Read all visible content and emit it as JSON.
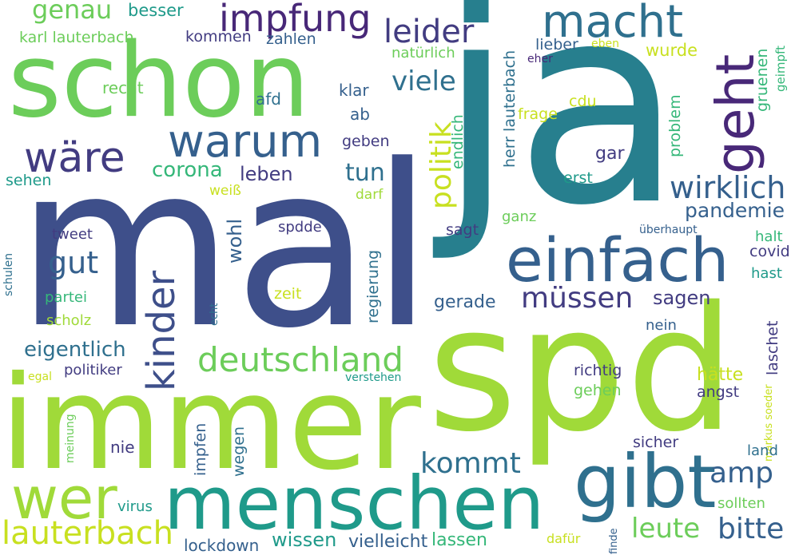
{
  "colors": {
    "indigo": "#423c81",
    "navy": "#3e4f8a",
    "blue": "#35608d",
    "steel": "#2f708e",
    "teal": "#277f8e",
    "sea": "#1f9a8a",
    "green": "#35b779",
    "lime": "#6ccd5a",
    "chartreuse": "#a0da39",
    "yellow": "#c8e020",
    "purple": "#482878"
  },
  "words": [
    {
      "text": "ja",
      "color": "teal"
    },
    {
      "text": "mal",
      "color": "navy"
    },
    {
      "text": "spd",
      "color": "chartreuse"
    },
    {
      "text": "immer",
      "color": "chartreuse"
    },
    {
      "text": "schon",
      "color": "lime"
    },
    {
      "text": "menschen",
      "color": "sea"
    },
    {
      "text": "gibt",
      "color": "steel"
    },
    {
      "text": "einfach",
      "color": "blue"
    },
    {
      "text": "geht",
      "color": "purple"
    },
    {
      "text": "wer",
      "color": "chartreuse"
    },
    {
      "text": "macht",
      "color": "steel"
    },
    {
      "text": "warum",
      "color": "blue"
    },
    {
      "text": "wäre",
      "color": "indigo"
    },
    {
      "text": "impfung",
      "color": "purple"
    },
    {
      "text": "kinder",
      "color": "navy"
    },
    {
      "text": "deutschland",
      "color": "lime"
    },
    {
      "text": "lauterbach",
      "color": "yellow"
    },
    {
      "text": "leider",
      "color": "indigo"
    },
    {
      "text": "wirklich",
      "color": "blue"
    },
    {
      "text": "müssen",
      "color": "indigo"
    },
    {
      "text": "politik",
      "color": "yellow"
    },
    {
      "text": "kommt",
      "color": "steel"
    },
    {
      "text": "amp",
      "color": "blue"
    },
    {
      "text": "bitte",
      "color": "blue"
    },
    {
      "text": "leute",
      "color": "lime"
    },
    {
      "text": "gut",
      "color": "blue"
    },
    {
      "text": "viele",
      "color": "steel"
    },
    {
      "text": "genau",
      "color": "lime"
    },
    {
      "text": "tun",
      "color": "steel"
    },
    {
      "text": "corona",
      "color": "green"
    },
    {
      "text": "eigentlich",
      "color": "steel"
    },
    {
      "text": "pandemie",
      "color": "blue"
    },
    {
      "text": "leben",
      "color": "indigo"
    },
    {
      "text": "sagen",
      "color": "indigo"
    },
    {
      "text": "wohl",
      "color": "blue"
    },
    {
      "text": "wissen",
      "color": "sea"
    },
    {
      "text": "vielleicht",
      "color": "blue"
    },
    {
      "text": "lassen",
      "color": "green"
    },
    {
      "text": "lockdown",
      "color": "blue"
    },
    {
      "text": "gar",
      "color": "indigo"
    },
    {
      "text": "gerade",
      "color": "blue"
    },
    {
      "text": "herr lauterbach",
      "color": "steel"
    },
    {
      "text": "besser",
      "color": "sea"
    },
    {
      "text": "karl lauterbach",
      "color": "lime"
    },
    {
      "text": "kommen",
      "color": "indigo"
    },
    {
      "text": "zahlen",
      "color": "blue"
    },
    {
      "text": "recht",
      "color": "lime"
    },
    {
      "text": "afd",
      "color": "steel"
    },
    {
      "text": "klar",
      "color": "blue"
    },
    {
      "text": "ab",
      "color": "blue"
    },
    {
      "text": "geben",
      "color": "indigo"
    },
    {
      "text": "natürlich",
      "color": "lime"
    },
    {
      "text": "lieber",
      "color": "blue"
    },
    {
      "text": "eben",
      "color": "yellow"
    },
    {
      "text": "eher",
      "color": "purple"
    },
    {
      "text": "wurde",
      "color": "yellow"
    },
    {
      "text": "gruenen",
      "color": "green"
    },
    {
      "text": "geimpft",
      "color": "green"
    },
    {
      "text": "cdu",
      "color": "yellow"
    },
    {
      "text": "frage",
      "color": "yellow"
    },
    {
      "text": "endlich",
      "color": "green"
    },
    {
      "text": "problem",
      "color": "green"
    },
    {
      "text": "erst",
      "color": "sea"
    },
    {
      "text": "sehen",
      "color": "sea"
    },
    {
      "text": "weiß",
      "color": "yellow"
    },
    {
      "text": "darf",
      "color": "chartreuse"
    },
    {
      "text": "ganz",
      "color": "lime"
    },
    {
      "text": "tweet",
      "color": "indigo"
    },
    {
      "text": "spdde",
      "color": "indigo"
    },
    {
      "text": "sagt",
      "color": "indigo"
    },
    {
      "text": "überhaupt",
      "color": "blue"
    },
    {
      "text": "halt",
      "color": "green"
    },
    {
      "text": "covid",
      "color": "indigo"
    },
    {
      "text": "hast",
      "color": "sea"
    },
    {
      "text": "schulen",
      "color": "steel"
    },
    {
      "text": "partei",
      "color": "green"
    },
    {
      "text": "zeit",
      "color": "yellow"
    },
    {
      "text": "scholz",
      "color": "chartreuse"
    },
    {
      "text": "echt",
      "color": "steel"
    },
    {
      "text": "regierung",
      "color": "steel"
    },
    {
      "text": "nein",
      "color": "blue"
    },
    {
      "text": "laschet",
      "color": "indigo"
    },
    {
      "text": "politiker",
      "color": "indigo"
    },
    {
      "text": "egal",
      "color": "yellow"
    },
    {
      "text": "verstehen",
      "color": "sea"
    },
    {
      "text": "richtig",
      "color": "indigo"
    },
    {
      "text": "hätte",
      "color": "yellow"
    },
    {
      "text": "gehen",
      "color": "lime"
    },
    {
      "text": "angst",
      "color": "indigo"
    },
    {
      "text": "markus soeder",
      "color": "yellow"
    },
    {
      "text": "meinung",
      "color": "lime"
    },
    {
      "text": "impfen",
      "color": "blue"
    },
    {
      "text": "nie",
      "color": "indigo"
    },
    {
      "text": "wegen",
      "color": "steel"
    },
    {
      "text": "sicher",
      "color": "indigo"
    },
    {
      "text": "land",
      "color": "steel"
    },
    {
      "text": "virus",
      "color": "sea"
    },
    {
      "text": "sollten",
      "color": "lime"
    },
    {
      "text": "dafür",
      "color": "yellow"
    },
    {
      "text": "finde",
      "color": "blue"
    }
  ]
}
